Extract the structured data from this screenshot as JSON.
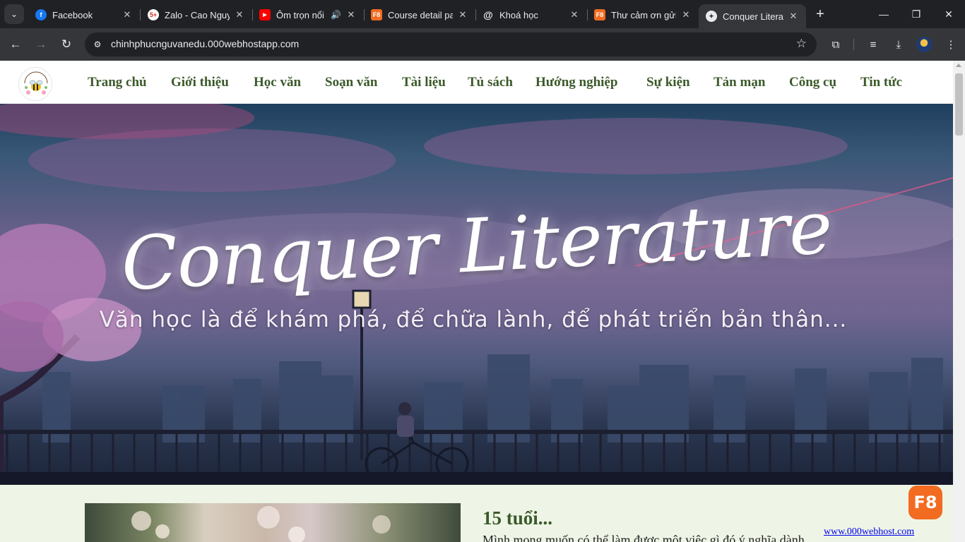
{
  "browser": {
    "tabs": [
      {
        "title": "Facebook",
        "favicon": "facebook-icon",
        "color": "#1877f2",
        "glyph": "f"
      },
      {
        "title": "Zalo - Cao Nguy",
        "favicon": "zalo-icon",
        "color": "#ffffff",
        "glyph": "5+"
      },
      {
        "title": "Ôm trọn nổi",
        "favicon": "youtube-icon",
        "color": "#ff0000",
        "glyph": "▶"
      },
      {
        "title": "Course detail pa",
        "favicon": "f8-icon",
        "color": "#f26b21",
        "glyph": "F8"
      },
      {
        "title": "Khoá học",
        "favicon": "spiral-icon",
        "color": "#3c4043",
        "glyph": "@"
      },
      {
        "title": "Thư cảm ơn gửi",
        "favicon": "f8-icon",
        "color": "#f26b21",
        "glyph": "F8"
      },
      {
        "title": "Conquer Literatu",
        "favicon": "compass-icon",
        "color": "#3c4043",
        "glyph": "✦"
      }
    ],
    "active_tab_index": 6,
    "url": "chinhphucnguvanedu.000webhostapp.com"
  },
  "site": {
    "nav": [
      "Trang chủ",
      "Giới thiệu",
      "Học văn",
      "Soạn văn",
      "Tài liệu",
      "Tủ sách",
      "Hướng nghiệp",
      "Sự kiện",
      "Tản mạn",
      "Công cụ",
      "Tin tức"
    ],
    "hero_title": "Conquer Literature",
    "hero_tagline": "Văn học là để khám phá, để chữa lành, để phát triển bản thân...",
    "post_title": "15 tuổi...",
    "post_excerpt": "Mình mong muốn có thể làm được một việc gì đó ý nghĩa dành",
    "f8_badge": "F8",
    "webhost_link": "www.000webhost.com"
  },
  "colors": {
    "nav_text": "#3b5a2a",
    "content_bg": "#eef5e6",
    "f8_orange": "#f26b21"
  }
}
